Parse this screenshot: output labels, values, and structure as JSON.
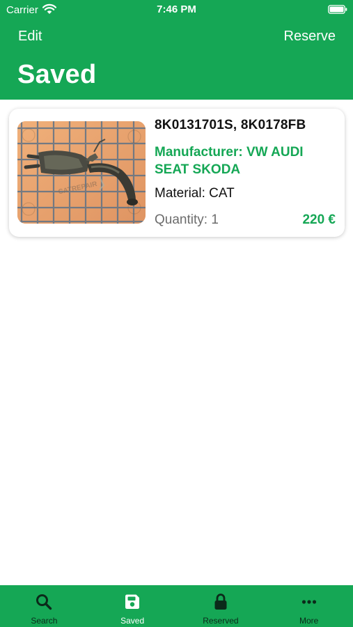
{
  "status_bar": {
    "carrier": "Carrier",
    "time": "7:46 PM"
  },
  "nav": {
    "edit_label": "Edit",
    "reserve_label": "Reserve",
    "title": "Saved"
  },
  "item": {
    "part_numbers": "8K0131701S, 8K0178FB",
    "manufacturer": "Manufacturer: VW AUDI SEAT SKODA",
    "material": "Material: CAT",
    "quantity": "Quantity: 1",
    "price": "220 €",
    "watermark": "CATREPAIR"
  },
  "tabs": [
    {
      "label": "Search",
      "icon": "search-icon"
    },
    {
      "label": "Saved",
      "icon": "save-icon",
      "active": true
    },
    {
      "label": "Reserved",
      "icon": "lock-icon"
    },
    {
      "label": "More",
      "icon": "more-icon"
    }
  ],
  "colors": {
    "brand_green": "#15a755",
    "inactive_tab": "#0b2a1a",
    "photo_background": "#e6a06a"
  }
}
